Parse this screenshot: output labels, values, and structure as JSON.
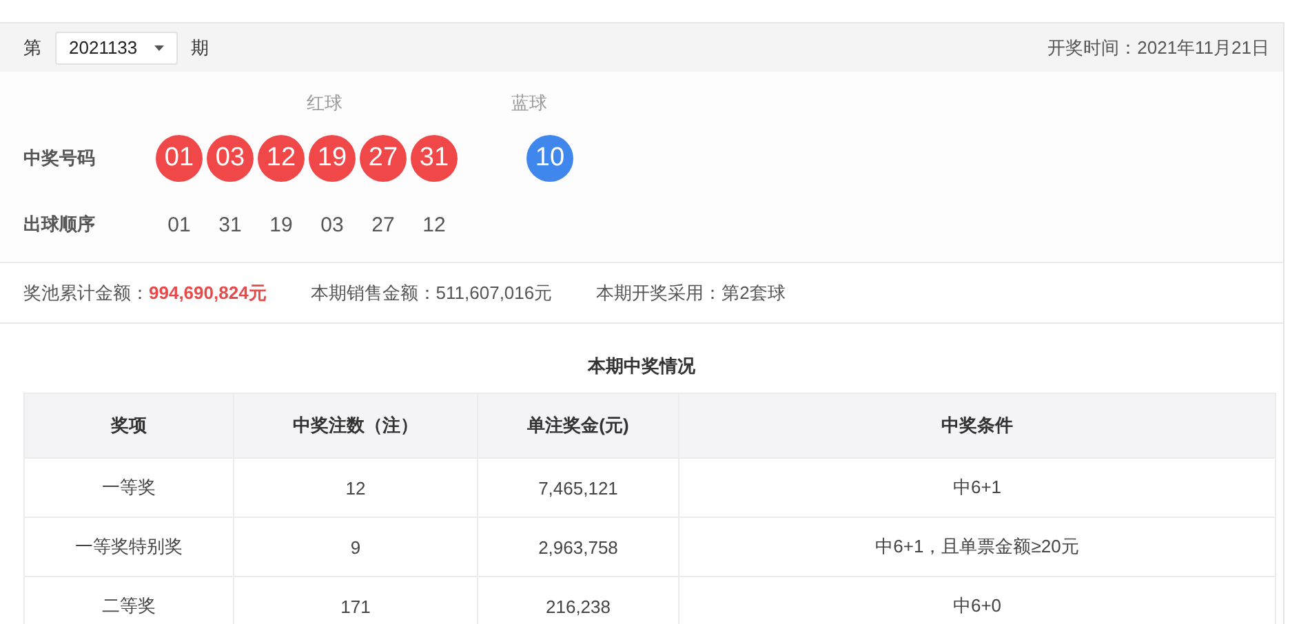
{
  "header": {
    "prefix": "第",
    "issue": "2021133",
    "suffix": "期",
    "draw_date": "开奖时间：2021年11月21日"
  },
  "balls": {
    "red_label": "红球",
    "blue_label": "蓝球",
    "winning_label": "中奖号码",
    "order_label": "出球顺序",
    "numbers": [
      {
        "value": "01",
        "color": "#f04848"
      },
      {
        "value": "03",
        "color": "#f04848"
      },
      {
        "value": "12",
        "color": "#f04848"
      },
      {
        "value": "19",
        "color": "#f04848"
      },
      {
        "value": "27",
        "color": "#f04848"
      },
      {
        "value": "31",
        "color": "#f04848"
      },
      {
        "value": "10",
        "color": "#3f86ed"
      }
    ],
    "order": [
      "01",
      "31",
      "19",
      "03",
      "27",
      "12"
    ]
  },
  "info": [
    {
      "label": "奖池累计金额：",
      "value": "994,690,824元",
      "highlight": true
    },
    {
      "label": "本期销售金额：",
      "value": "511,607,016元",
      "highlight": false
    },
    {
      "label": "本期开奖采用：",
      "value": "第2套球",
      "highlight": false
    }
  ],
  "table": {
    "title": "本期中奖情况",
    "columns": [
      "奖项",
      "中奖注数（注）",
      "单注奖金(元)",
      "中奖条件"
    ],
    "rows": [
      [
        "一等奖",
        "12",
        "7,465,121",
        "中6+1"
      ],
      [
        "一等奖特别奖",
        "9",
        "2,963,758",
        "中6+1，且单票金额≥20元"
      ],
      [
        "二等奖",
        "171",
        "216,238",
        "中6+0"
      ]
    ]
  }
}
